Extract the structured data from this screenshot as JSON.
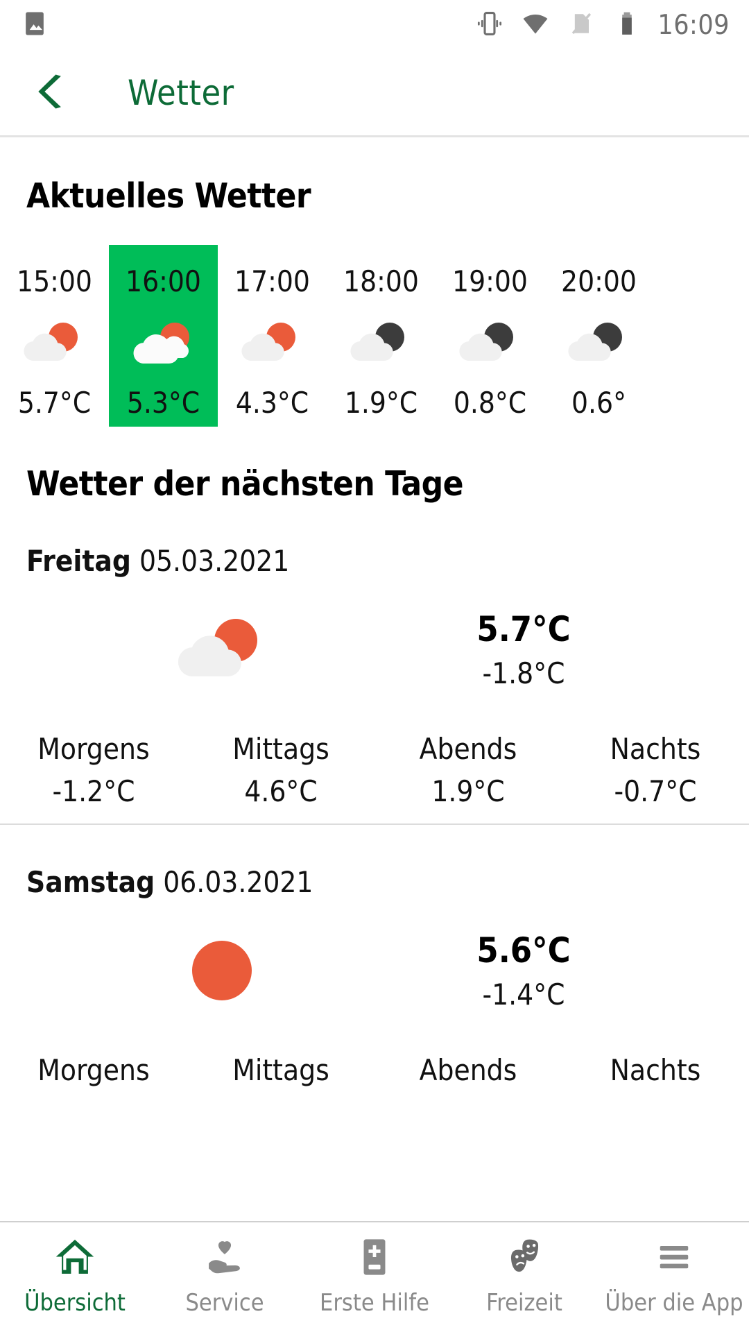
{
  "status_bar": {
    "time": "16:09",
    "icons": [
      "image-icon",
      "vibrate-icon",
      "wifi-icon",
      "sim-off-icon",
      "battery-icon"
    ]
  },
  "app_bar": {
    "back_icon": "chevron-left-icon",
    "title": "Wetter",
    "accent_color": "#0d6b37"
  },
  "current_weather": {
    "heading": "Aktuelles Wetter",
    "highlight_color": "#00bd58",
    "hours": [
      {
        "time": "15:00",
        "temp": "5.7°C",
        "icon": "partly-cloudy-day-icon",
        "active": false
      },
      {
        "time": "16:00",
        "temp": "5.3°C",
        "icon": "cloudy-day-icon",
        "active": true
      },
      {
        "time": "17:00",
        "temp": "4.3°C",
        "icon": "partly-cloudy-day-icon",
        "active": false
      },
      {
        "time": "18:00",
        "temp": "1.9°C",
        "icon": "partly-cloudy-night-icon",
        "active": false
      },
      {
        "time": "19:00",
        "temp": "0.8°C",
        "icon": "partly-cloudy-night-icon",
        "active": false
      },
      {
        "time": "20:00",
        "temp": "0.6°",
        "icon": "partly-cloudy-night-icon",
        "active": false
      }
    ]
  },
  "forecast": {
    "heading": "Wetter der nächsten Tage",
    "part_labels": [
      "Morgens",
      "Mittags",
      "Abends",
      "Nachts"
    ],
    "days": [
      {
        "weekday": "Freitag",
        "date": "05.03.2021",
        "icon": "partly-cloudy-day-icon",
        "high": "5.7°C",
        "low": "-1.8°C",
        "parts": [
          {
            "label": "Morgens",
            "value": "-1.2°C"
          },
          {
            "label": "Mittags",
            "value": "4.6°C"
          },
          {
            "label": "Abends",
            "value": "1.9°C"
          },
          {
            "label": "Nachts",
            "value": "-0.7°C"
          }
        ]
      },
      {
        "weekday": "Samstag",
        "date": "06.03.2021",
        "icon": "sunny-icon",
        "high": "5.6°C",
        "low": "-1.4°C",
        "parts": [
          {
            "label": "Morgens",
            "value": ""
          },
          {
            "label": "Mittags",
            "value": ""
          },
          {
            "label": "Abends",
            "value": ""
          },
          {
            "label": "Nachts",
            "value": ""
          }
        ]
      }
    ]
  },
  "bottom_nav": {
    "items": [
      {
        "label": "Übersicht",
        "icon": "home-icon",
        "active": true
      },
      {
        "label": "Service",
        "icon": "heart-in-hand-icon",
        "active": false
      },
      {
        "label": "Erste Hilfe",
        "icon": "first-aid-book-icon",
        "active": false
      },
      {
        "label": "Freizeit",
        "icon": "theater-masks-icon",
        "active": false
      },
      {
        "label": "Über die App",
        "icon": "hamburger-menu-icon",
        "active": false
      }
    ],
    "active_color": "#0d6b37",
    "inactive_color": "#8a8a8a"
  }
}
